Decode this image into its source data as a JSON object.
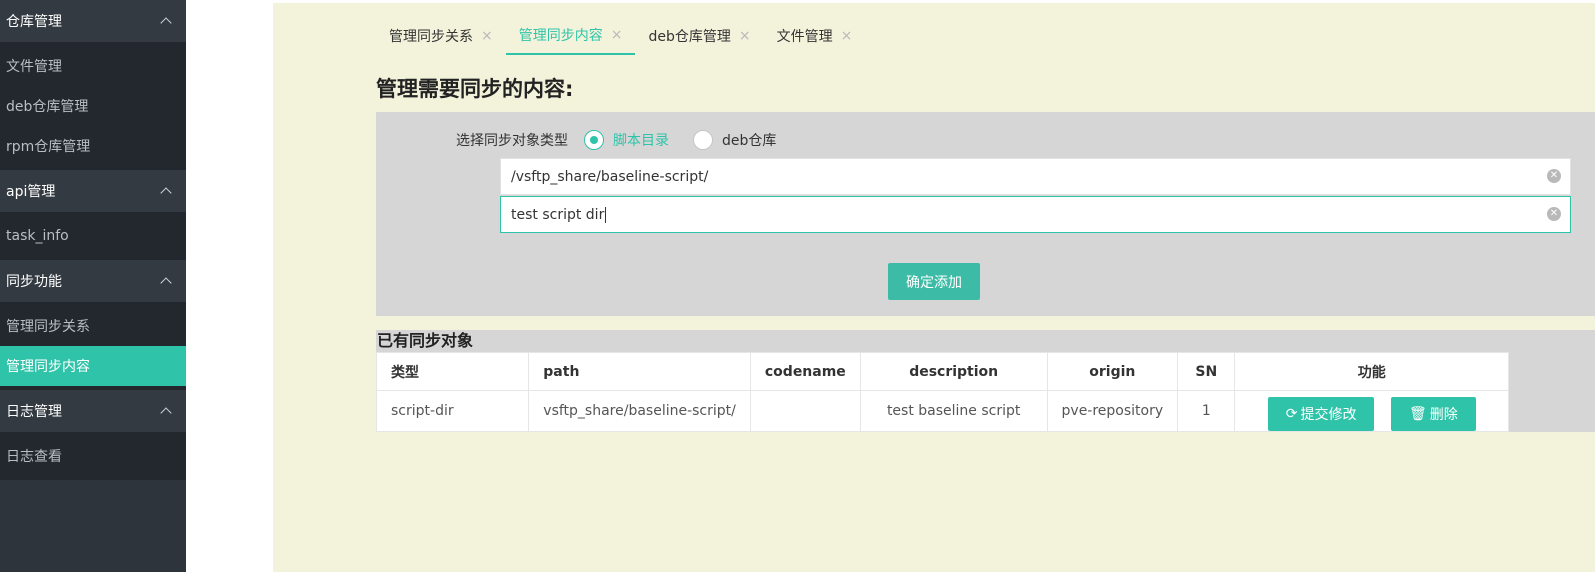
{
  "sidebar": {
    "groups": [
      {
        "title": "仓库管理",
        "items": [
          "文件管理",
          "deb仓库管理",
          "rpm仓库管理"
        ]
      },
      {
        "title": "api管理",
        "items": [
          "task_info"
        ]
      },
      {
        "title": "同步功能",
        "items": [
          "管理同步关系",
          "管理同步内容"
        ],
        "active_index": 1
      },
      {
        "title": "日志管理",
        "items": [
          "日志查看"
        ]
      }
    ]
  },
  "tabs": [
    {
      "label": "管理同步关系",
      "active": false
    },
    {
      "label": "管理同步内容",
      "active": true
    },
    {
      "label": "deb仓库管理",
      "active": false
    },
    {
      "label": "文件管理",
      "active": false
    }
  ],
  "page_title": "管理需要同步的内容:",
  "form": {
    "type_label": "选择同步对象类型",
    "options": [
      {
        "label": "脚本目录",
        "checked": true
      },
      {
        "label": "deb仓库",
        "checked": false
      }
    ],
    "path_value": "/vsftp_share/baseline-script/",
    "description_value": "test script dir",
    "submit_label": "确定添加"
  },
  "list": {
    "title": "已有同步对象",
    "columns": [
      "类型",
      "path",
      "codename",
      "description",
      "origin",
      "SN",
      "功能"
    ],
    "rows": [
      {
        "type": "script-dir",
        "path": "vsftp_share/baseline-script/",
        "codename": "",
        "description": "test baseline script",
        "origin": "pve-repository",
        "sn": "1"
      }
    ],
    "actions": {
      "edit": "提交修改",
      "delete": "删除"
    }
  },
  "colors": {
    "accent": "#2fc4a9",
    "sidebar_bg": "#2d343b",
    "content_bg": "#f3f3dc",
    "panel_bg": "#d6d6d6"
  },
  "icons": {
    "clear": "clear-circle-icon",
    "close_tab": "close-icon",
    "refresh": "refresh-icon",
    "trash": "trash-icon",
    "chevron": "chevron-up-icon"
  }
}
